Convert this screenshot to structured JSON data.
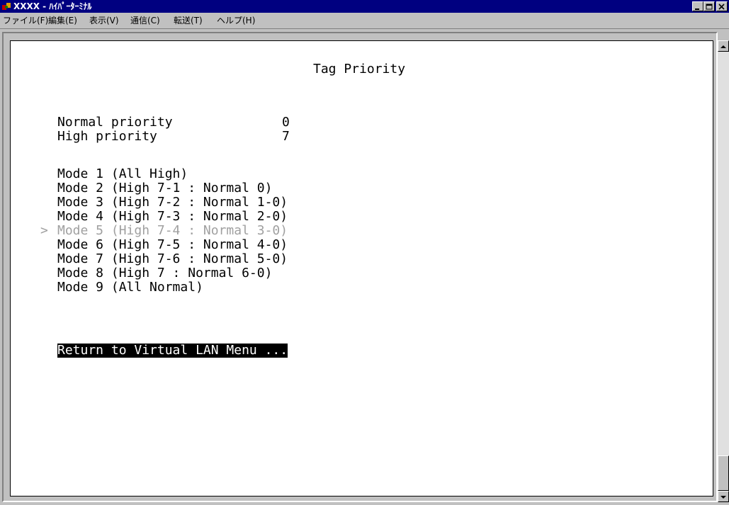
{
  "window": {
    "title": "XXXX - ﾊｲﾊﾟｰﾀｰﾐﾅﾙ",
    "icon": "hyperterminal-icon",
    "controls": [
      "minimize-icon",
      "maximize-icon",
      "close-icon"
    ]
  },
  "menu": {
    "items": [
      "ファイル(F)",
      "編集(E)",
      "表示(V)",
      "通信(C)",
      "転送(T)",
      "ヘルプ(H)"
    ]
  },
  "terminal": {
    "title": "Tag Priority",
    "normal_priority_label": "Normal priority",
    "normal_priority_value": "0",
    "high_priority_label": "High priority",
    "high_priority_value": "7",
    "cursor": ">",
    "modes": [
      "Mode 1 (All High)",
      "Mode 2 (High 7-1 : Normal 0)",
      "Mode 3 (High 7-2 : Normal 1-0)",
      "Mode 4 (High 7-3 : Normal 2-0)",
      "Mode 5 (High 7-4 : Normal 3-0)",
      "Mode 6 (High 7-5 : Normal 4-0)",
      "Mode 7 (High 7-6 : Normal 5-0)",
      "Mode 8 (High 7 : Normal 6-0)",
      "Mode 9 (All Normal)"
    ],
    "return_label": "Return to Virtual LAN Menu ..."
  }
}
